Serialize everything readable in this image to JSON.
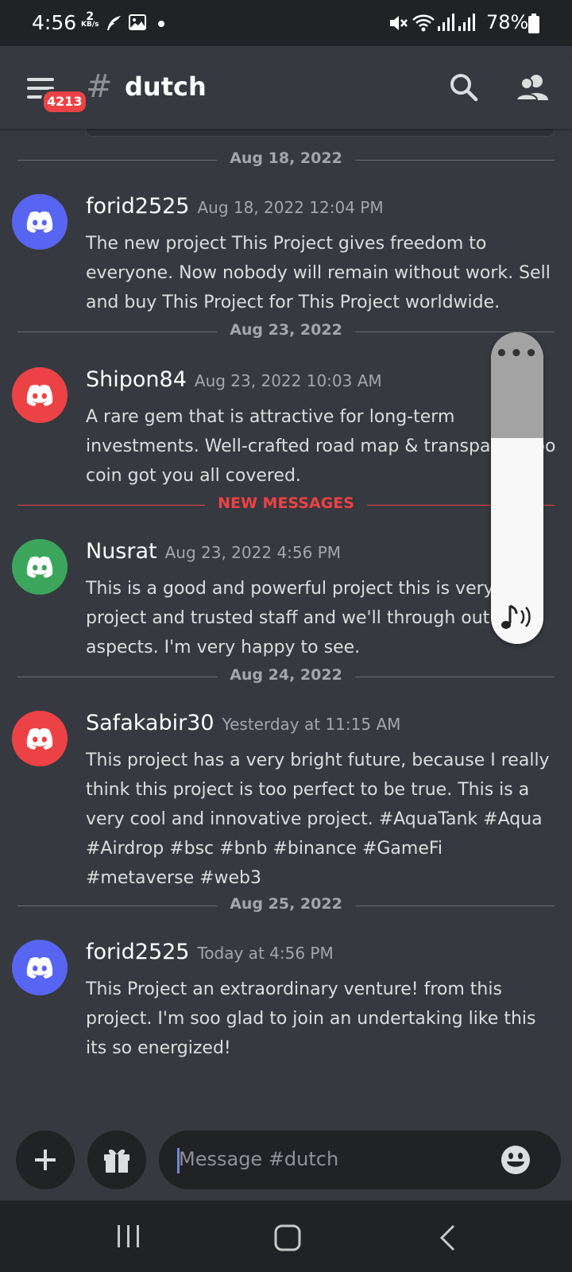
{
  "status_bar": {
    "time": "4:56",
    "net_speed_value": "2",
    "net_speed_unit": "KB/s",
    "battery": "78%"
  },
  "header": {
    "badge_count": "4213",
    "hash": "#",
    "channel_name": "dutch"
  },
  "messages": [
    {
      "type": "divider",
      "label": "Aug 18, 2022"
    },
    {
      "type": "message",
      "author": "forid2525",
      "timestamp": "Aug 18, 2022 12:04 PM",
      "avatar_color": "#5865f2",
      "text": "The new project This Project gives freedom to everyone. Now nobody will remain without work. Sell and buy This Project for This Project worldwide."
    },
    {
      "type": "divider",
      "label": "Aug 23, 2022"
    },
    {
      "type": "message",
      "author": "Shipon84",
      "timestamp": "Aug 23, 2022 10:03 AM",
      "avatar_color": "#ed4245",
      "text": "A rare gem that is attractive for long-term investments. Well-crafted road map & transpar Kazoo coin got you all covered."
    },
    {
      "type": "divider",
      "label": "NEW MESSAGES"
    },
    {
      "type": "message",
      "author": "Nusrat",
      "timestamp": "Aug 23, 2022 4:56 PM",
      "avatar_color": "#3ba55c",
      "text": "This is a good and powerful project this is very project and trusted staff and we'll through out in all aspects. I'm very happy to see."
    },
    {
      "type": "divider",
      "label": "Aug 24, 2022"
    },
    {
      "type": "message",
      "author": "Safakabir30",
      "timestamp": "Yesterday at 11:15 AM",
      "avatar_color": "#ed4245",
      "text": "This project has a very bright future, because I really think this project is too perfect to be true. This is a very cool and innovative project. #AquaTank #Aqua #Airdrop #bsc #bnb #binance #GameFi #metaverse #web3"
    },
    {
      "type": "divider",
      "label": "Aug 25, 2022"
    },
    {
      "type": "message",
      "author": "forid2525",
      "timestamp": "Today at 4:56 PM",
      "avatar_color": "#5865f2",
      "text": "This Project an extraordinary venture!  from this project. I'm soo glad to join an undertaking like this its so energized!"
    }
  ],
  "volume_panel": {
    "menu_glyph": "•••",
    "level_fraction": 0.66
  },
  "composer": {
    "placeholder": "Message #dutch"
  },
  "colors": {
    "background": "#36393f",
    "bars": "#202225",
    "accent_red": "#ed4245",
    "blurple": "#5865f2",
    "green": "#3ba55c"
  }
}
